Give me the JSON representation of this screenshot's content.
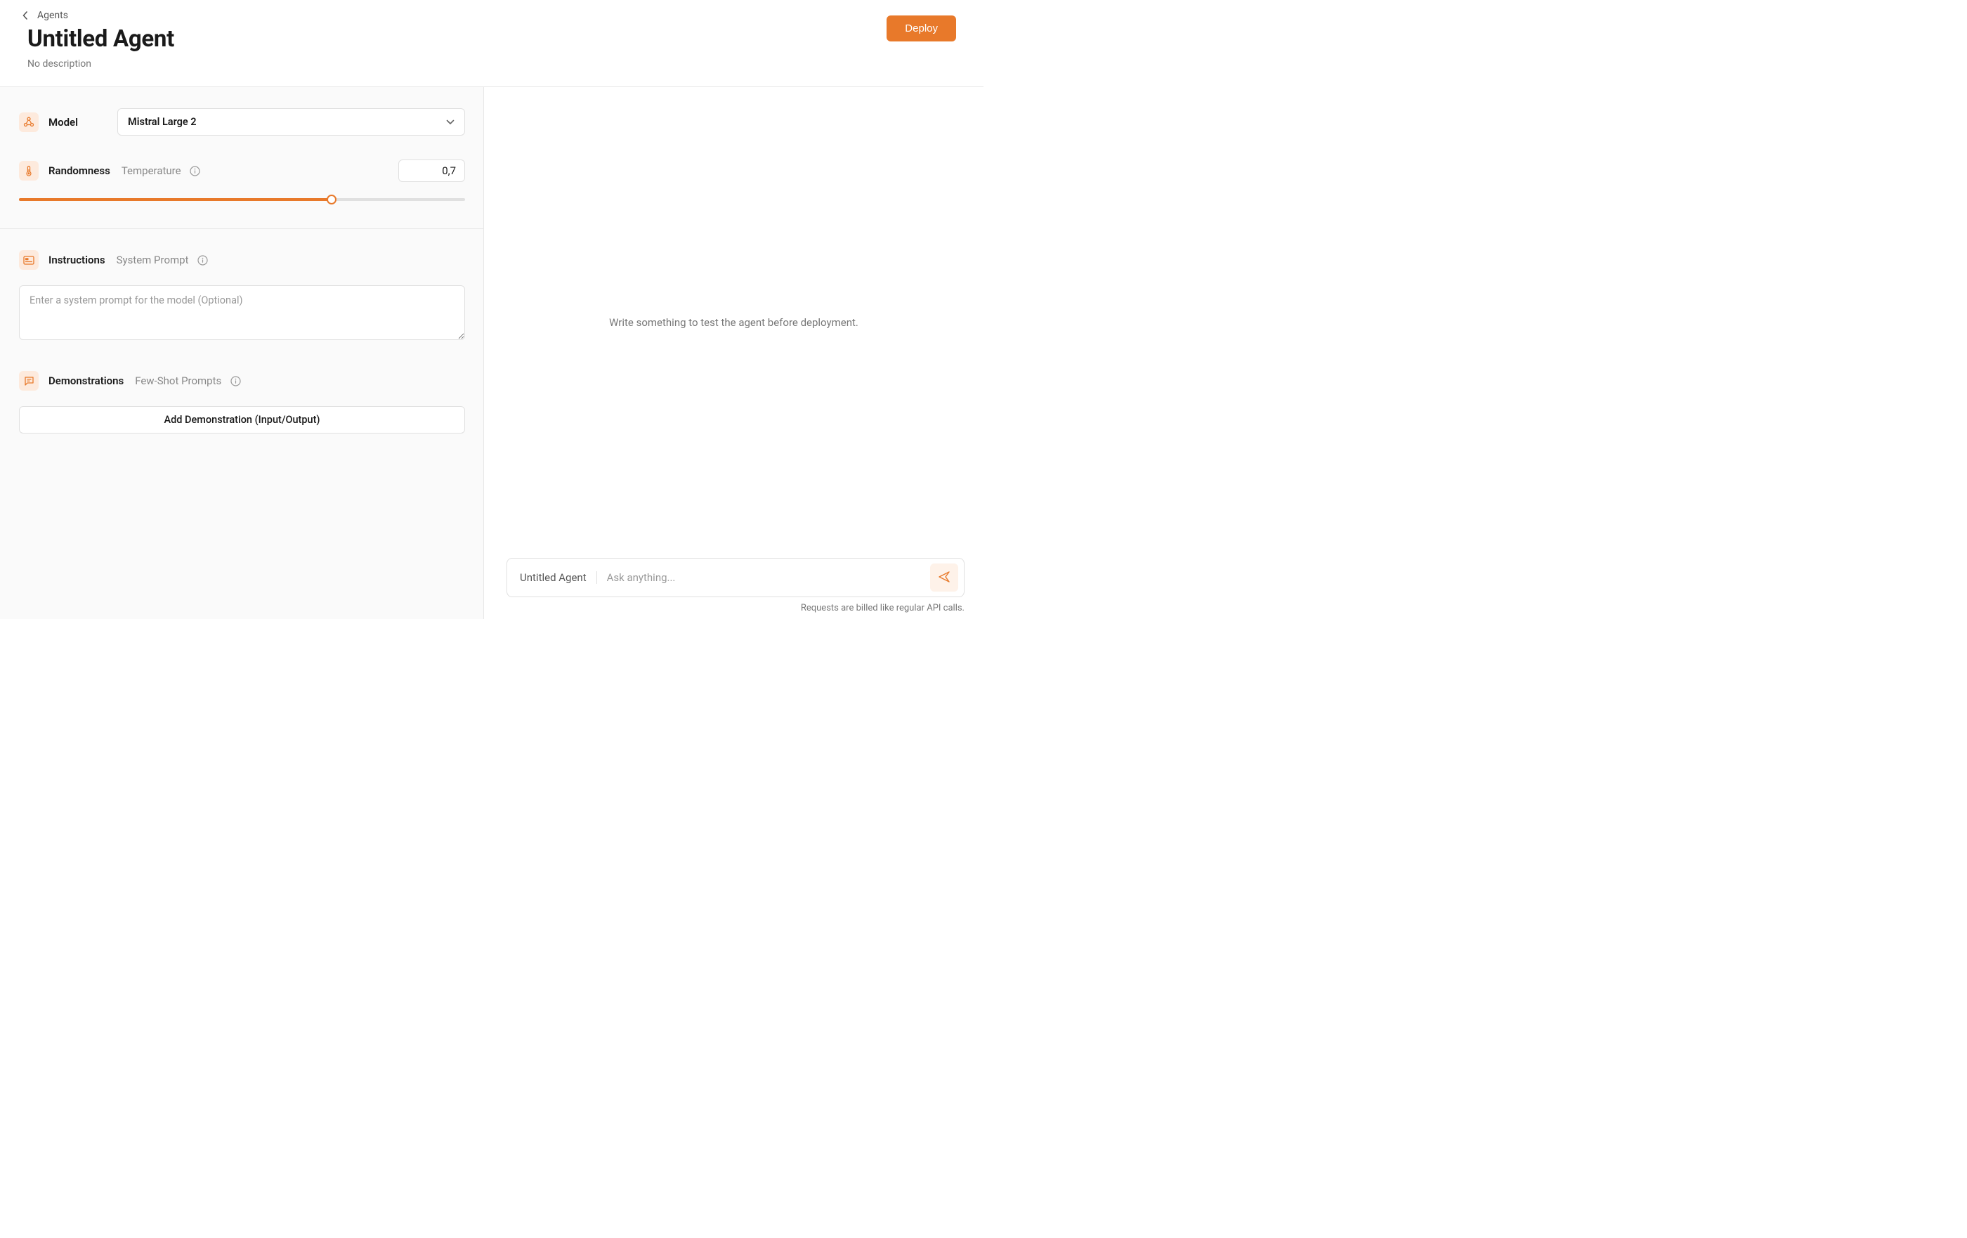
{
  "header": {
    "breadcrumb": "Agents",
    "title": "Untitled Agent",
    "subtitle": "No description",
    "deploy_label": "Deploy"
  },
  "model": {
    "label": "Model",
    "selected": "Mistral Large 2"
  },
  "randomness": {
    "label": "Randomness",
    "sublabel": "Temperature",
    "value": "0,7"
  },
  "instructions": {
    "label": "Instructions",
    "sublabel": "System Prompt",
    "placeholder": "Enter a system prompt for the model (Optional)"
  },
  "demonstrations": {
    "label": "Demonstrations",
    "sublabel": "Few-Shot Prompts",
    "add_button": "Add Demonstration (Input/Output)"
  },
  "playground": {
    "empty_text": "Write something to test the agent before deployment.",
    "agent_name": "Untitled Agent",
    "input_placeholder": "Ask anything...",
    "billing_note": "Requests are billed like regular API calls."
  },
  "colors": {
    "accent": "#e8792a",
    "accent_light": "#fdeadd"
  }
}
